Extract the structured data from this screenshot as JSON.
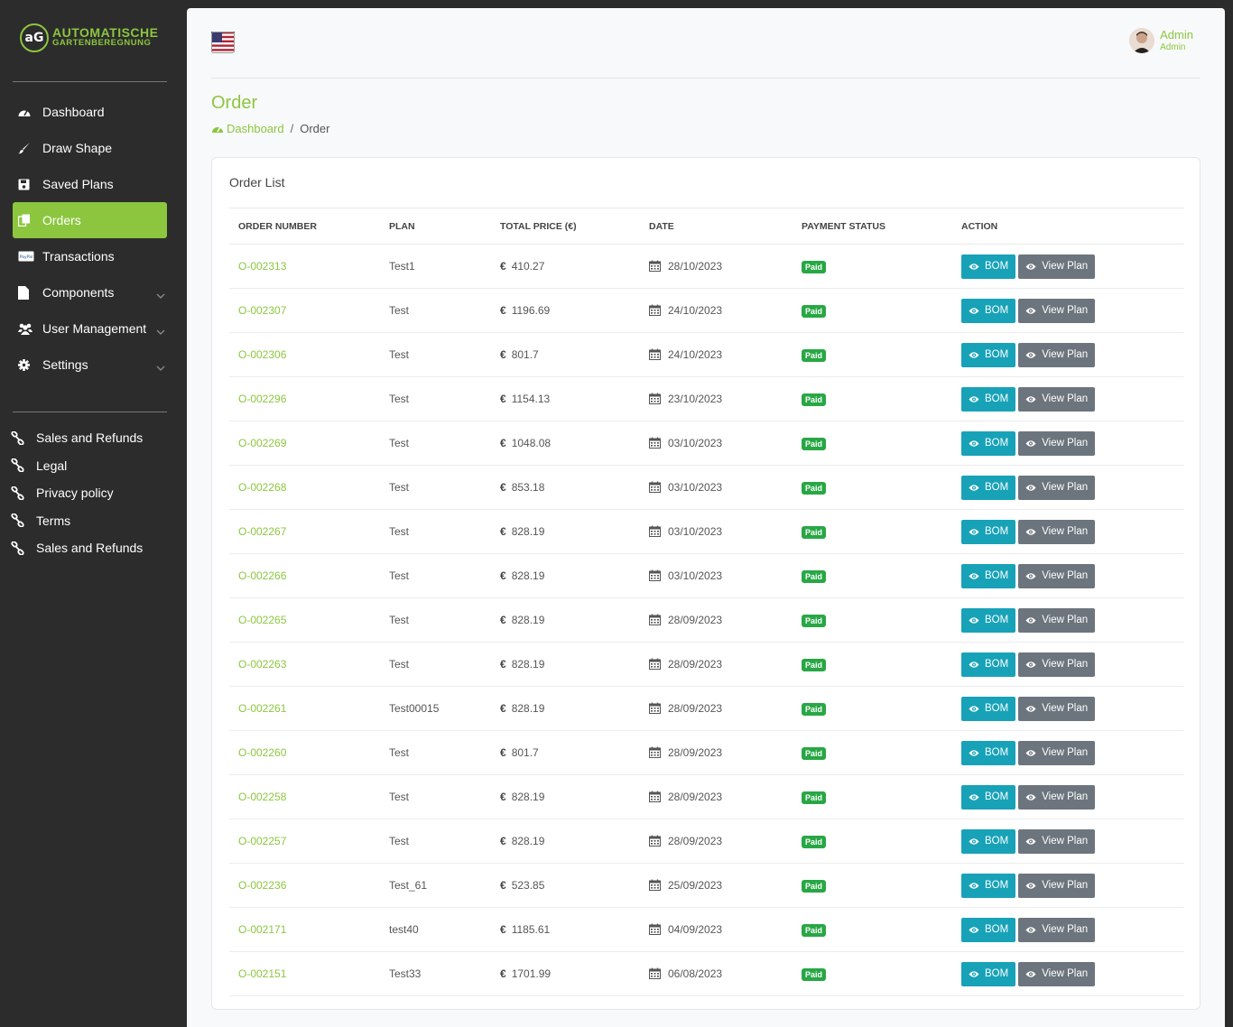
{
  "brand": {
    "mark": "aG",
    "line1": "AUTOMATISCHE",
    "line2": "GARTENBEREGNUNG"
  },
  "sidebar": {
    "items": [
      {
        "label": "Dashboard",
        "icon": "dashboard-icon"
      },
      {
        "label": "Draw Shape",
        "icon": "brush-icon"
      },
      {
        "label": "Saved Plans",
        "icon": "save-icon"
      },
      {
        "label": "Orders",
        "icon": "copy-icon",
        "active": true
      },
      {
        "label": "Transactions",
        "icon": "paypal-icon"
      },
      {
        "label": "Components",
        "icon": "file-icon",
        "expandable": true
      },
      {
        "label": "User Management",
        "icon": "users-icon",
        "expandable": true
      },
      {
        "label": "Settings",
        "icon": "gear-icon",
        "expandable": true
      }
    ],
    "links": [
      "Sales and Refunds",
      "Legal",
      "Privacy policy",
      "Terms",
      "Sales and Refunds"
    ]
  },
  "header": {
    "user_name": "Admin",
    "user_role": "Admin"
  },
  "page": {
    "title": "Order",
    "breadcrumb_home": "Dashboard",
    "breadcrumb_current": "Order"
  },
  "orders": {
    "title": "Order List",
    "columns": [
      "ORDER NUMBER",
      "PLAN",
      "TOTAL PRICE (€)",
      "DATE",
      "PAYMENT STATUS",
      "ACTION"
    ],
    "currency_symbol": "€",
    "bom_label": "BOM",
    "view_label": "View Plan",
    "rows": [
      {
        "number": "O-002313",
        "plan": "Test1",
        "price": "410.27",
        "date": "28/10/2023",
        "status": "Paid"
      },
      {
        "number": "O-002307",
        "plan": "Test",
        "price": "1196.69",
        "date": "24/10/2023",
        "status": "Paid"
      },
      {
        "number": "O-002306",
        "plan": "Test",
        "price": "801.7",
        "date": "24/10/2023",
        "status": "Paid"
      },
      {
        "number": "O-002296",
        "plan": "Test",
        "price": "1154.13",
        "date": "23/10/2023",
        "status": "Paid"
      },
      {
        "number": "O-002269",
        "plan": "Test",
        "price": "1048.08",
        "date": "03/10/2023",
        "status": "Paid"
      },
      {
        "number": "O-002268",
        "plan": "Test",
        "price": "853.18",
        "date": "03/10/2023",
        "status": "Paid"
      },
      {
        "number": "O-002267",
        "plan": "Test",
        "price": "828.19",
        "date": "03/10/2023",
        "status": "Paid"
      },
      {
        "number": "O-002266",
        "plan": "Test",
        "price": "828.19",
        "date": "03/10/2023",
        "status": "Paid"
      },
      {
        "number": "O-002265",
        "plan": "Test",
        "price": "828.19",
        "date": "28/09/2023",
        "status": "Paid"
      },
      {
        "number": "O-002263",
        "plan": "Test",
        "price": "828.19",
        "date": "28/09/2023",
        "status": "Paid"
      },
      {
        "number": "O-002261",
        "plan": "Test00015",
        "price": "828.19",
        "date": "28/09/2023",
        "status": "Paid"
      },
      {
        "number": "O-002260",
        "plan": "Test",
        "price": "801.7",
        "date": "28/09/2023",
        "status": "Paid"
      },
      {
        "number": "O-002258",
        "plan": "Test",
        "price": "828.19",
        "date": "28/09/2023",
        "status": "Paid"
      },
      {
        "number": "O-002257",
        "plan": "Test",
        "price": "828.19",
        "date": "28/09/2023",
        "status": "Paid"
      },
      {
        "number": "O-002236",
        "plan": "Test_61",
        "price": "523.85",
        "date": "25/09/2023",
        "status": "Paid"
      },
      {
        "number": "O-002171",
        "plan": "test40",
        "price": "1185.61",
        "date": "04/09/2023",
        "status": "Paid"
      },
      {
        "number": "O-002151",
        "plan": "Test33",
        "price": "1701.99",
        "date": "06/08/2023",
        "status": "Paid"
      }
    ]
  },
  "colors": {
    "brand_green": "#8cc63f",
    "bom_button": "#17a2b8",
    "view_button": "#6c757d",
    "paid_badge": "#28a745",
    "sidebar_bg": "#2c2c2c"
  }
}
